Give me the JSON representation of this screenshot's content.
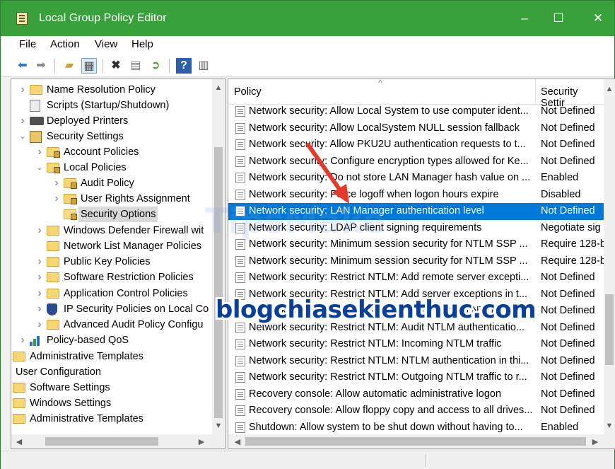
{
  "window": {
    "title": "Local Group Policy Editor",
    "controls": {
      "minimize": "–",
      "maximize": "☐",
      "close": "✕"
    }
  },
  "menu": [
    "File",
    "Action",
    "View",
    "Help"
  ],
  "toolbar": [
    "back",
    "forward",
    "up-folder",
    "show-hide-tree",
    "delete",
    "properties",
    "export",
    "help",
    "filter"
  ],
  "tree": [
    {
      "label": "Name Resolution Policy",
      "icon": "folder",
      "chevron": "right"
    },
    {
      "label": "Scripts (Startup/Shutdown)",
      "icon": "script",
      "chevron": ""
    },
    {
      "label": "Deployed Printers",
      "icon": "printer",
      "chevron": "right"
    },
    {
      "label": "Security Settings",
      "icon": "security-settings",
      "chevron": "down"
    },
    {
      "label": "Account Policies",
      "icon": "folder-lock",
      "chevron": "right"
    },
    {
      "label": "Local Policies",
      "icon": "folder-lock",
      "chevron": "down"
    },
    {
      "label": "Audit Policy",
      "icon": "folder-lock",
      "chevron": "right"
    },
    {
      "label": "User Rights Assignment",
      "icon": "folder-lock",
      "chevron": "right"
    },
    {
      "label": "Security Options",
      "icon": "folder-lock",
      "chevron": "",
      "selected": true
    },
    {
      "label": "Windows Defender Firewall wit",
      "icon": "folder",
      "chevron": "right"
    },
    {
      "label": "Network List Manager Policies",
      "icon": "folder",
      "chevron": ""
    },
    {
      "label": "Public Key Policies",
      "icon": "folder",
      "chevron": "right"
    },
    {
      "label": "Software Restriction Policies",
      "icon": "folder",
      "chevron": "right"
    },
    {
      "label": "Application Control Policies",
      "icon": "folder",
      "chevron": "right"
    },
    {
      "label": "IP Security Policies on Local Co",
      "icon": "ipsec-shield",
      "chevron": "right"
    },
    {
      "label": "Advanced Audit Policy Configu",
      "icon": "folder",
      "chevron": "right"
    },
    {
      "label": "Policy-based QoS",
      "icon": "qos-chart",
      "chevron": "right"
    },
    {
      "label": "Administrative Templates",
      "icon": "folder",
      "chevron": "right"
    },
    {
      "label": "User Configuration",
      "icon": "",
      "chevron": ""
    },
    {
      "label": "Software Settings",
      "icon": "folder",
      "chevron": ""
    },
    {
      "label": "Windows Settings",
      "icon": "folder",
      "chevron": ""
    },
    {
      "label": "Administrative Templates",
      "icon": "folder",
      "chevron": ""
    }
  ],
  "list": {
    "columns": {
      "policy": "Policy",
      "setting": "Security Settir"
    },
    "rows": [
      {
        "policy": "Network security: Allow Local System to use computer ident...",
        "setting": "Not Defined"
      },
      {
        "policy": "Network security: Allow LocalSystem NULL session fallback",
        "setting": "Not Defined"
      },
      {
        "policy": "Network security: Allow PKU2U authentication requests to t...",
        "setting": "Not Defined"
      },
      {
        "policy": "Network security: Configure encryption types allowed for Ke...",
        "setting": "Not Defined"
      },
      {
        "policy": "Network security: Do not store LAN Manager hash value on ...",
        "setting": "Enabled"
      },
      {
        "policy": "Network security: Force logoff when logon hours expire",
        "setting": "Disabled"
      },
      {
        "policy": "Network security: LAN Manager authentication level",
        "setting": "Not Defined",
        "selected": true
      },
      {
        "policy": "Network security: LDAP client signing requirements",
        "setting": "Negotiate sig"
      },
      {
        "policy": "Network security: Minimum session security for NTLM SSP ...",
        "setting": "Require 128-b"
      },
      {
        "policy": "Network security: Minimum session security for NTLM SSP ...",
        "setting": "Require 128-b"
      },
      {
        "policy": "Network security: Restrict NTLM: Add remote server excepti...",
        "setting": "Not Defined"
      },
      {
        "policy": "Network security: Restrict NTLM: Add server exceptions in t...",
        "setting": "Not Defined"
      },
      {
        "policy": "Network security: Restrict NTLM: Audit Incoming NTLM Traf...",
        "setting": "Not Defined"
      },
      {
        "policy": "Network security: Restrict NTLM: Audit NTLM authenticatio...",
        "setting": "Not Defined"
      },
      {
        "policy": "Network security: Restrict NTLM: Incoming NTLM traffic",
        "setting": "Not Defined"
      },
      {
        "policy": "Network security: Restrict NTLM: NTLM authentication in thi...",
        "setting": "Not Defined"
      },
      {
        "policy": "Network security: Restrict NTLM: Outgoing NTLM traffic to r...",
        "setting": "Not Defined"
      },
      {
        "policy": "Recovery console: Allow automatic administrative logon",
        "setting": "Not Defined"
      },
      {
        "policy": "Recovery console: Allow floppy copy and access to all drives...",
        "setting": "Not Defined"
      },
      {
        "policy": "Shutdown: Allow system to be shut down without having to...",
        "setting": "Enabled"
      }
    ]
  },
  "overlay": {
    "watermark": "blogchiasekienthuc.com",
    "faint_watermark": "TipsMake"
  },
  "colors": {
    "titlebar": "#38a13c",
    "selection": "#0078d7",
    "watermark": "#0a3f9c",
    "annotation_arrow": "#e23b2e"
  }
}
